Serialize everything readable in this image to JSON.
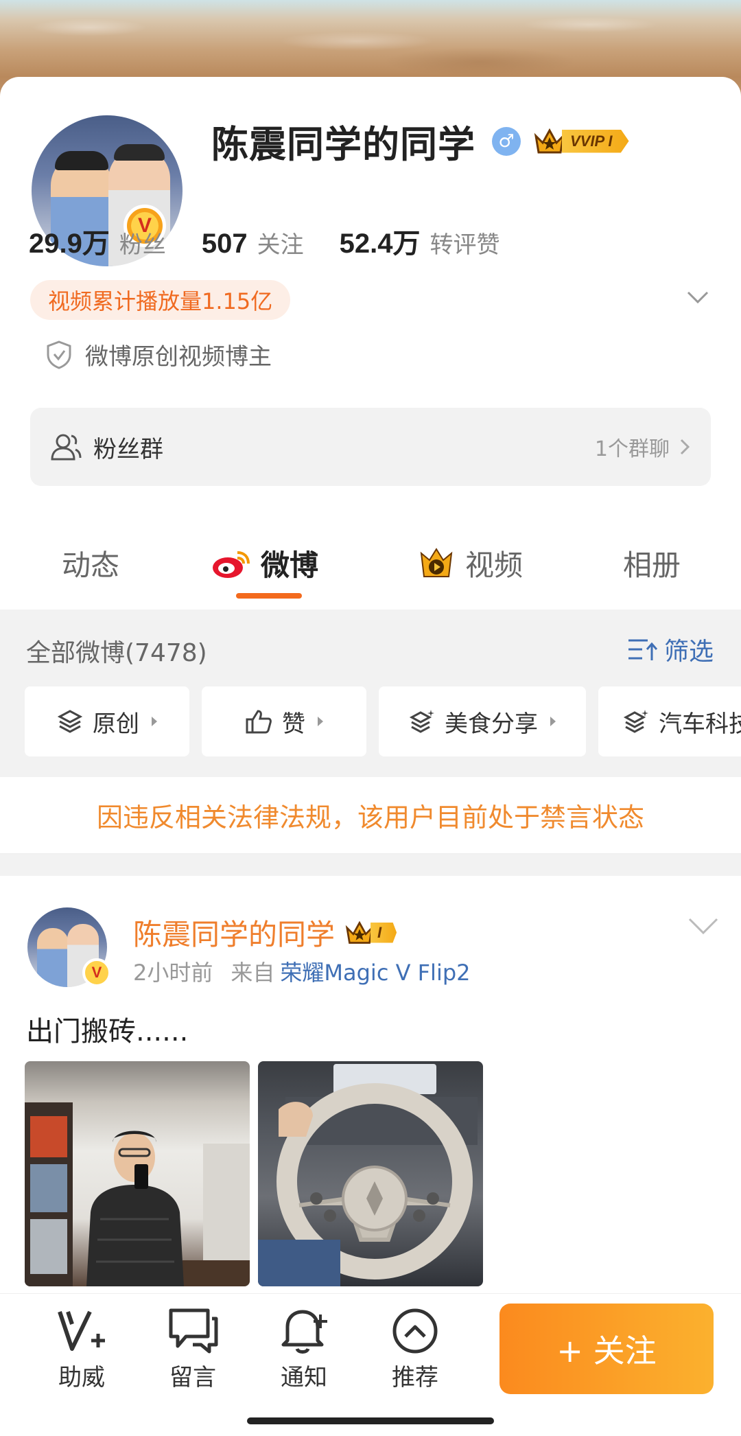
{
  "profile": {
    "name": "陈震同学的同学",
    "vip_label": "VVIP I",
    "stats": [
      {
        "num": "29.9万",
        "label": "粉丝"
      },
      {
        "num": "507",
        "label": "关注"
      },
      {
        "num": "52.4万",
        "label": "转评赞"
      }
    ],
    "video_plays": "视频累计播放量1.15亿",
    "certification": "微博原创视频博主",
    "fans_group": {
      "label": "粉丝群",
      "count": "1个群聊"
    }
  },
  "tabs": [
    "动态",
    "微博",
    "视频",
    "相册"
  ],
  "active_tab": "微博",
  "filter": {
    "header": "全部微博(7478)",
    "button": "筛选",
    "chips": [
      "原创",
      "赞",
      "美食分享",
      "汽车科技"
    ]
  },
  "banned_notice": "因违反相关法律法规，该用户目前处于禁言状态",
  "post": {
    "author": "陈震同学的同学",
    "vip_label": "I",
    "time": "2小时前",
    "from_label": "来自",
    "source": "荣耀Magic V Flip2",
    "text": "出门搬砖......"
  },
  "bottom_bar": {
    "items": [
      "助威",
      "留言",
      "通知",
      "推荐"
    ],
    "follow": "+ 关注"
  },
  "colors": {
    "accent": "#f36a1d",
    "link": "#3f6fb5",
    "post_name": "#ef7e2c",
    "notice": "#f08a2e"
  }
}
